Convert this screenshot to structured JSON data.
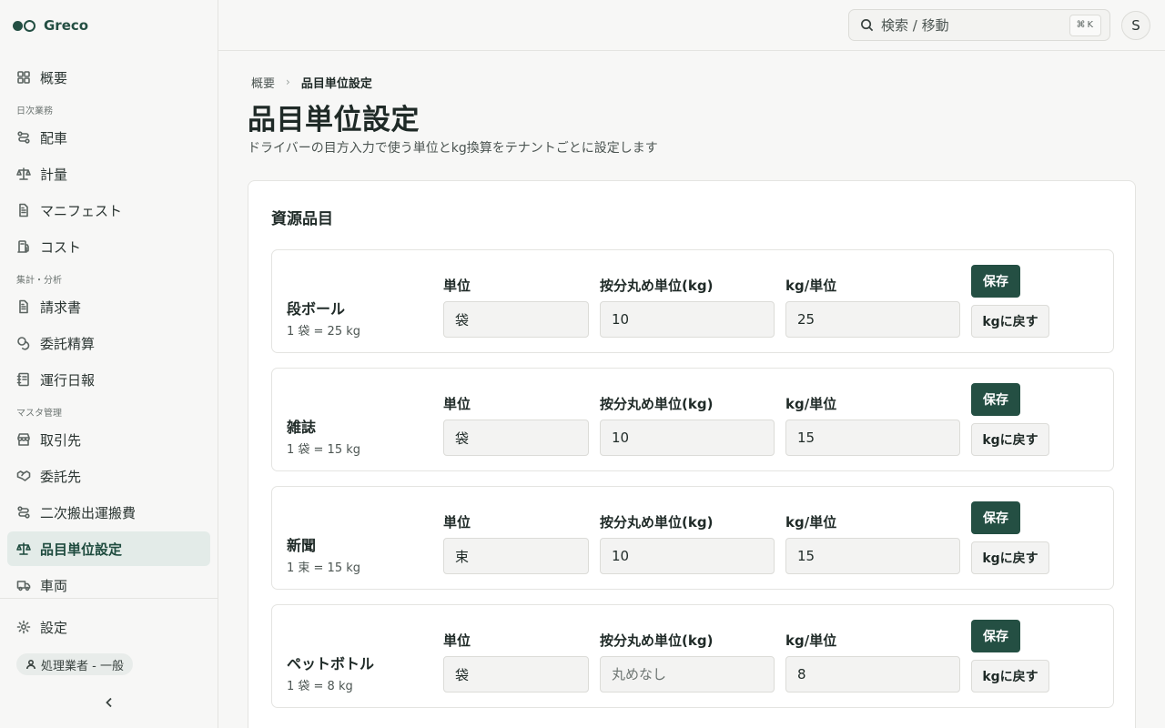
{
  "brand": {
    "name": "Greco"
  },
  "sidebar": {
    "items": [
      {
        "label": "概要",
        "icon": "grid-icon"
      },
      {
        "section": "日次業務"
      },
      {
        "label": "配車",
        "icon": "route-icon"
      },
      {
        "label": "計量",
        "icon": "scale-icon"
      },
      {
        "label": "マニフェスト",
        "icon": "document-icon"
      },
      {
        "label": "コスト",
        "icon": "fuel-icon"
      },
      {
        "section": "集計・分析"
      },
      {
        "label": "請求書",
        "icon": "document-icon"
      },
      {
        "label": "委託精算",
        "icon": "coins-icon"
      },
      {
        "label": "運行日報",
        "icon": "notebook-icon"
      },
      {
        "section": "マスタ管理"
      },
      {
        "label": "取引先",
        "icon": "store-icon"
      },
      {
        "label": "委託先",
        "icon": "handshake-icon"
      },
      {
        "label": "二次搬出運搬費",
        "icon": "route-icon"
      },
      {
        "label": "品目単位設定",
        "icon": "scale-icon",
        "active": true
      },
      {
        "label": "車両",
        "icon": "truck-icon"
      }
    ],
    "settings_label": "設定",
    "role_label": "処理業者 - 一般"
  },
  "topbar": {
    "search_placeholder": "検索 / 移動",
    "search_shortcut": "⌘K",
    "avatar_initial": "S"
  },
  "breadcrumb": {
    "parent": "概要",
    "separator": "›",
    "current": "品目単位設定"
  },
  "page": {
    "title": "品目単位設定",
    "subtitle": "ドライバーの目方入力で使う単位とkg換算をテナントごとに設定します"
  },
  "card": {
    "title": "資源品目"
  },
  "labels": {
    "unit": "単位",
    "rounding": "按分丸め単位(kg)",
    "kg_per_unit": "kg/単位",
    "save": "保存",
    "reset": "kgに戻す",
    "rounding_placeholder": "丸めなし"
  },
  "materials": [
    {
      "name": "段ボール",
      "conversion": "1 袋 = 25 kg",
      "unit": "袋",
      "rounding": "10",
      "kg_per_unit": "25"
    },
    {
      "name": "雑誌",
      "conversion": "1 袋 = 15 kg",
      "unit": "袋",
      "rounding": "10",
      "kg_per_unit": "15"
    },
    {
      "name": "新聞",
      "conversion": "1 束 = 15 kg",
      "unit": "束",
      "rounding": "10",
      "kg_per_unit": "15"
    },
    {
      "name": "ペットボトル",
      "conversion": "1 袋 = 8 kg",
      "unit": "袋",
      "rounding": "",
      "kg_per_unit": "8"
    }
  ]
}
